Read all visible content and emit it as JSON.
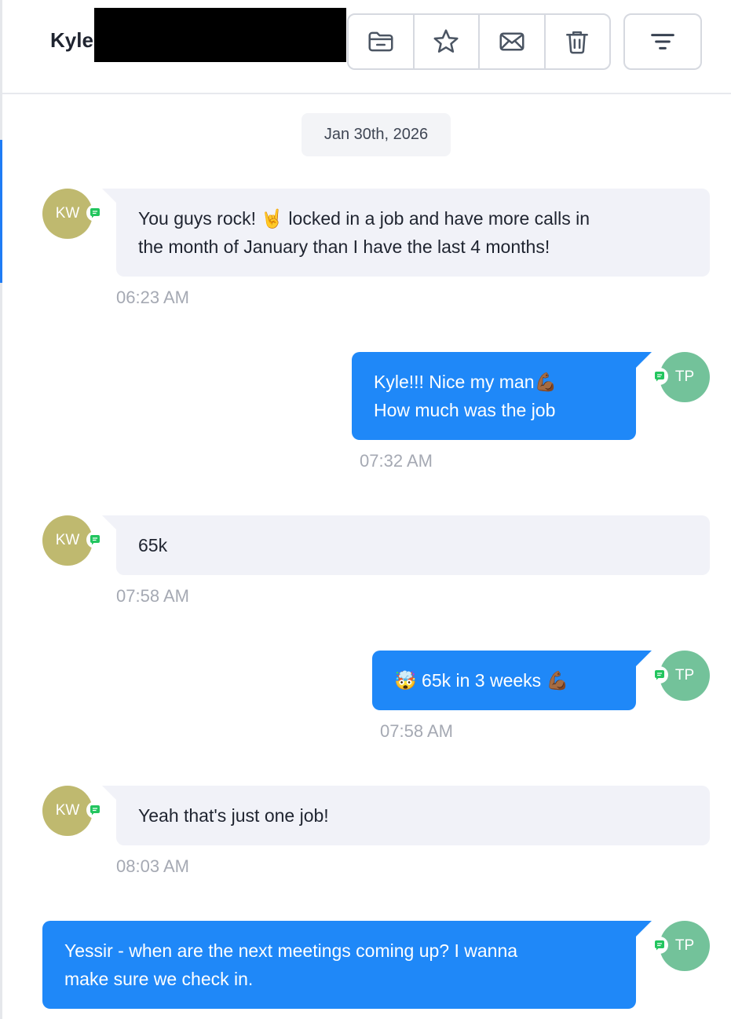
{
  "conversation": {
    "contact_name": "Kyle",
    "date_separator": "Jan 30th, 2026"
  },
  "toolbar": {
    "icons": [
      "folder-minus-icon",
      "star-icon",
      "mail-icon",
      "trash-icon"
    ],
    "filter_icon": "filter-icon"
  },
  "colors": {
    "outgoing_bubble": "#1f88f8",
    "incoming_bubble": "#f1f2f8",
    "kw_avatar": "#bfb96f",
    "tp_avatar": "#73c29a",
    "sms_badge": "#22c55e",
    "active_accent": "#1f7cf5"
  },
  "messages": [
    {
      "direction": "incoming",
      "initials": "KW",
      "line1": "You guys rock! 🤘 locked in a job and have more calls in",
      "line2": "the month of January than I have the last 4 months!",
      "time": "06:23 AM"
    },
    {
      "direction": "outgoing",
      "initials": "TP",
      "line1": "Kyle!!! Nice my man💪🏾",
      "line2": "How much was the job",
      "time": "07:32 AM"
    },
    {
      "direction": "incoming",
      "initials": "KW",
      "text": "65k",
      "time": "07:58 AM"
    },
    {
      "direction": "outgoing",
      "initials": "TP",
      "text": "🤯 65k in 3 weeks 💪🏾",
      "time": "07:58 AM"
    },
    {
      "direction": "incoming",
      "initials": "KW",
      "text": "Yeah that's just one job!",
      "time": "08:03 AM"
    },
    {
      "direction": "outgoing",
      "initials": "TP",
      "line1": "Yessir - when are the next meetings coming up? I wanna",
      "line2": "make sure we check in."
    }
  ]
}
